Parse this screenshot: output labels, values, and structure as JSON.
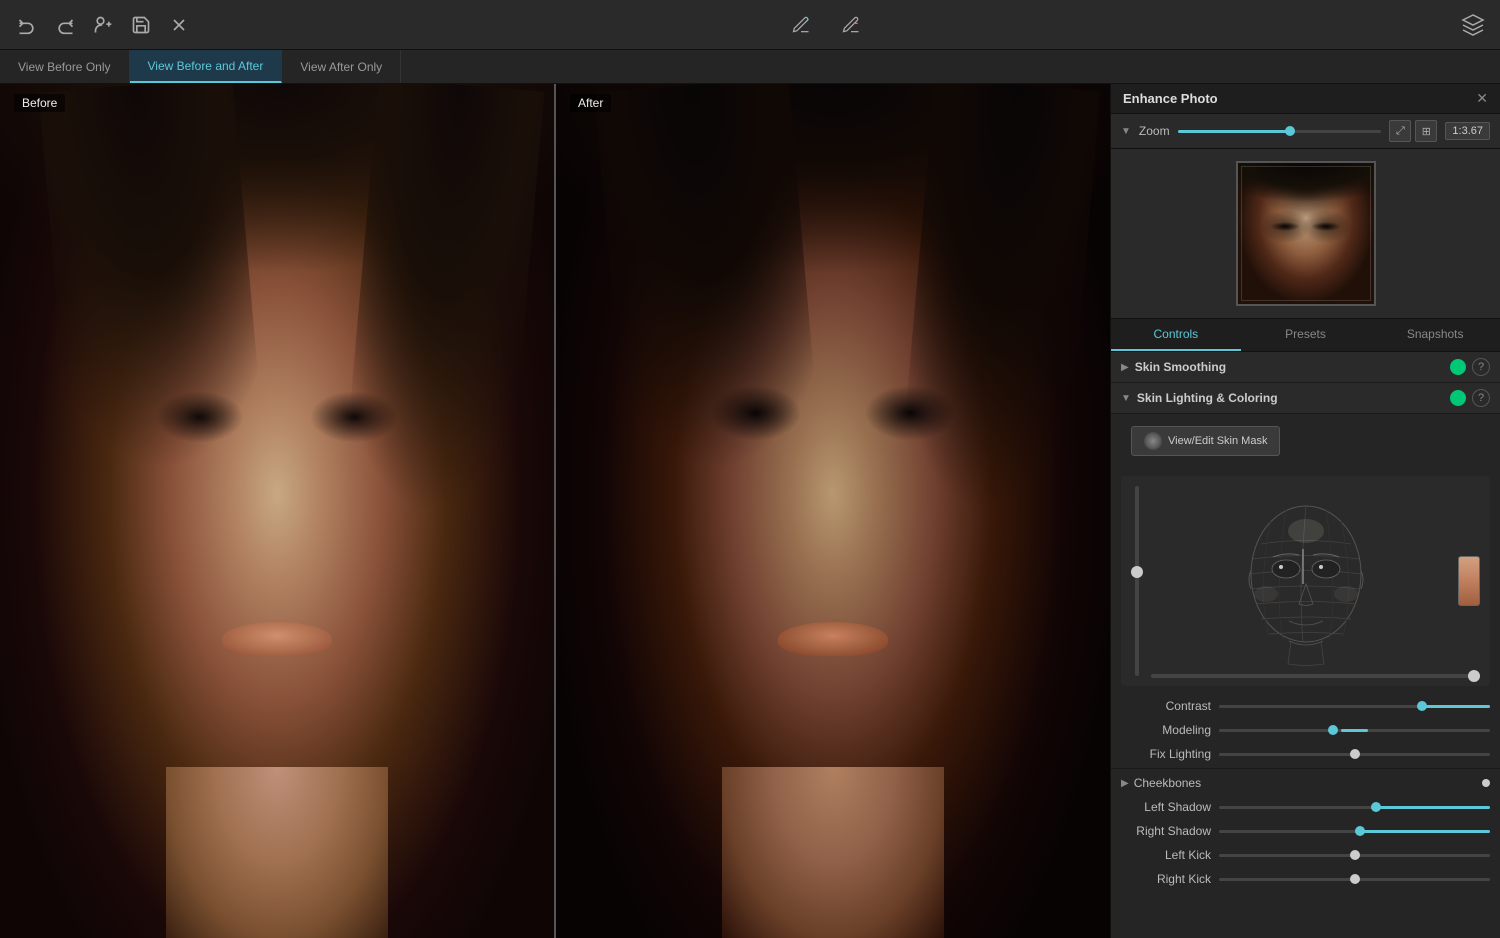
{
  "app": {
    "title": "Enhance Photo"
  },
  "toolbar": {
    "undo_label": "↩",
    "redo_label": "↪",
    "add_person_label": "👤+",
    "save_label": "💾",
    "close_label": "✕",
    "pen_add_label": "✎+",
    "pen_remove_label": "✎-",
    "layers_label": "⊟"
  },
  "view_tabs": [
    {
      "id": "before-only",
      "label": "View Before Only",
      "active": false
    },
    {
      "id": "before-and",
      "label": "View Before and After",
      "active": true
    },
    {
      "id": "after-only",
      "label": "View After Only",
      "active": false
    }
  ],
  "canvas": {
    "before_label": "Before",
    "after_label": "After"
  },
  "sidebar": {
    "title": "Enhance Photo",
    "zoom": {
      "label": "Zoom",
      "value": "1:3.67"
    },
    "controls_tabs": [
      {
        "id": "controls",
        "label": "Controls",
        "active": true
      },
      {
        "id": "presets",
        "label": "Presets",
        "active": false
      },
      {
        "id": "snapshots",
        "label": "Snapshots",
        "active": false
      }
    ],
    "skin_smoothing_section": {
      "title": "Skin Smoothing",
      "power": true
    },
    "skin_lighting_section": {
      "title": "Skin Lighting & Coloring",
      "power": true
    },
    "skin_mask_btn": "View/Edit Skin Mask",
    "sliders": {
      "contrast": {
        "label": "Contrast",
        "value": 75,
        "type": "right"
      },
      "modeling": {
        "label": "Modeling",
        "value": 42,
        "type": "center"
      },
      "fix_lighting": {
        "label": "Fix Lighting",
        "value": 50,
        "type": "center"
      },
      "cheekbones_label": "Cheekbones",
      "left_shadow": {
        "label": "Left Shadow",
        "value": 58,
        "type": "right"
      },
      "right_shadow": {
        "label": "Right Shadow",
        "value": 52,
        "type": "right"
      },
      "left_kick": {
        "label": "Left Kick",
        "value": 50,
        "type": "center"
      },
      "right_kick": {
        "label": "Right Kick",
        "value": 50,
        "type": "center"
      }
    }
  }
}
